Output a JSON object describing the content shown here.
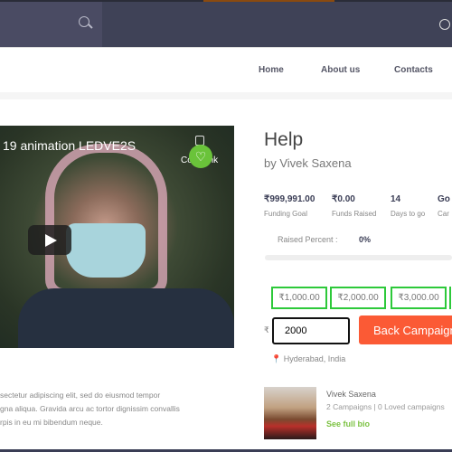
{
  "header": {
    "nav": [
      "Home",
      "About us",
      "Contacts"
    ]
  },
  "video": {
    "title": "19 animation LEDVE2S",
    "copy_link": "Copy link"
  },
  "campaign": {
    "title": "Help",
    "byline": "by Vivek Saxena",
    "stats": [
      {
        "value": "₹999,991.00",
        "label": "Funding Goal"
      },
      {
        "value": "₹0.00",
        "label": "Funds Raised"
      },
      {
        "value": "14",
        "label": "Days to go"
      },
      {
        "value": "Go",
        "label": "Car"
      }
    ],
    "raised_label": "Raised Percent :",
    "raised_value": "0%",
    "raised_fraction": 0,
    "amounts": [
      "₹1,000.00",
      "₹2,000.00",
      "₹3,000.00"
    ],
    "currency": "₹",
    "amount_value": "2000",
    "back_label": "Back Campaign",
    "location": "Hyderabad, India"
  },
  "author": {
    "name": "Vivek Saxena",
    "campaigns": "2 Campaigns | 0 Loved campaigns",
    "bio_link": "See full bio"
  },
  "description": [
    "sectetur adipiscing elit, sed do eiusmod tempor",
    "gna aliqua. Gravida arcu ac tortor dignissim convallis",
    "rpis in eu mi bibendum neque."
  ]
}
